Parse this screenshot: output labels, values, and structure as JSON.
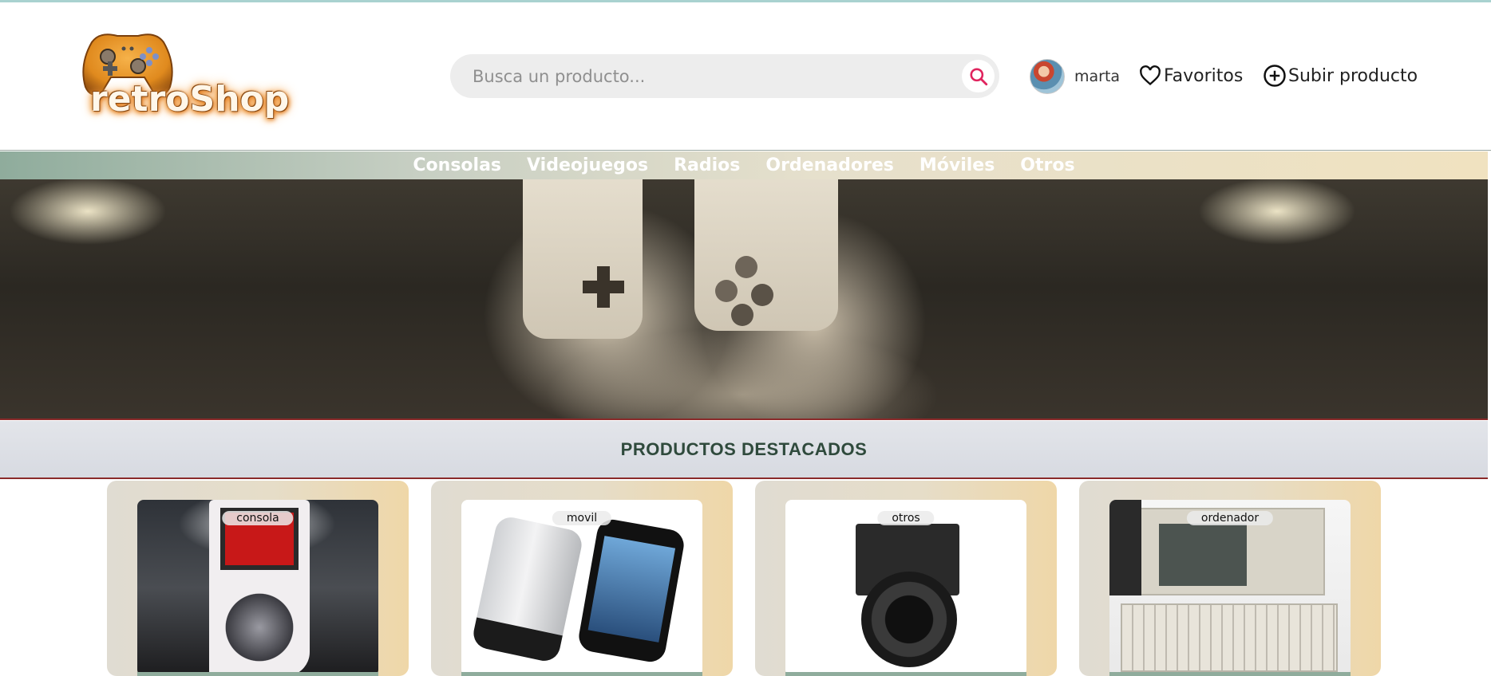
{
  "header": {
    "logo_text": "retroShop",
    "search": {
      "placeholder": "Busca un producto..."
    },
    "user": {
      "name": "marta"
    },
    "favorites_label": "Favoritos",
    "upload_label": "Subir producto"
  },
  "categories": [
    "Consolas",
    "Videojuegos",
    "Radios",
    "Ordenadores",
    "Móviles",
    "Otros"
  ],
  "section": {
    "title": "PRODUCTOS DESTACADOS"
  },
  "products": [
    {
      "tag": "consola"
    },
    {
      "tag": "movil"
    },
    {
      "tag": "otros"
    },
    {
      "tag": "ordenador"
    }
  ],
  "colors": {
    "accent_search": "#e0245e",
    "nav_gradient_start": "#8fac9c",
    "nav_gradient_end": "#f0e2c0",
    "section_title": "#2f4a3c",
    "divider": "#8a2a2a"
  }
}
